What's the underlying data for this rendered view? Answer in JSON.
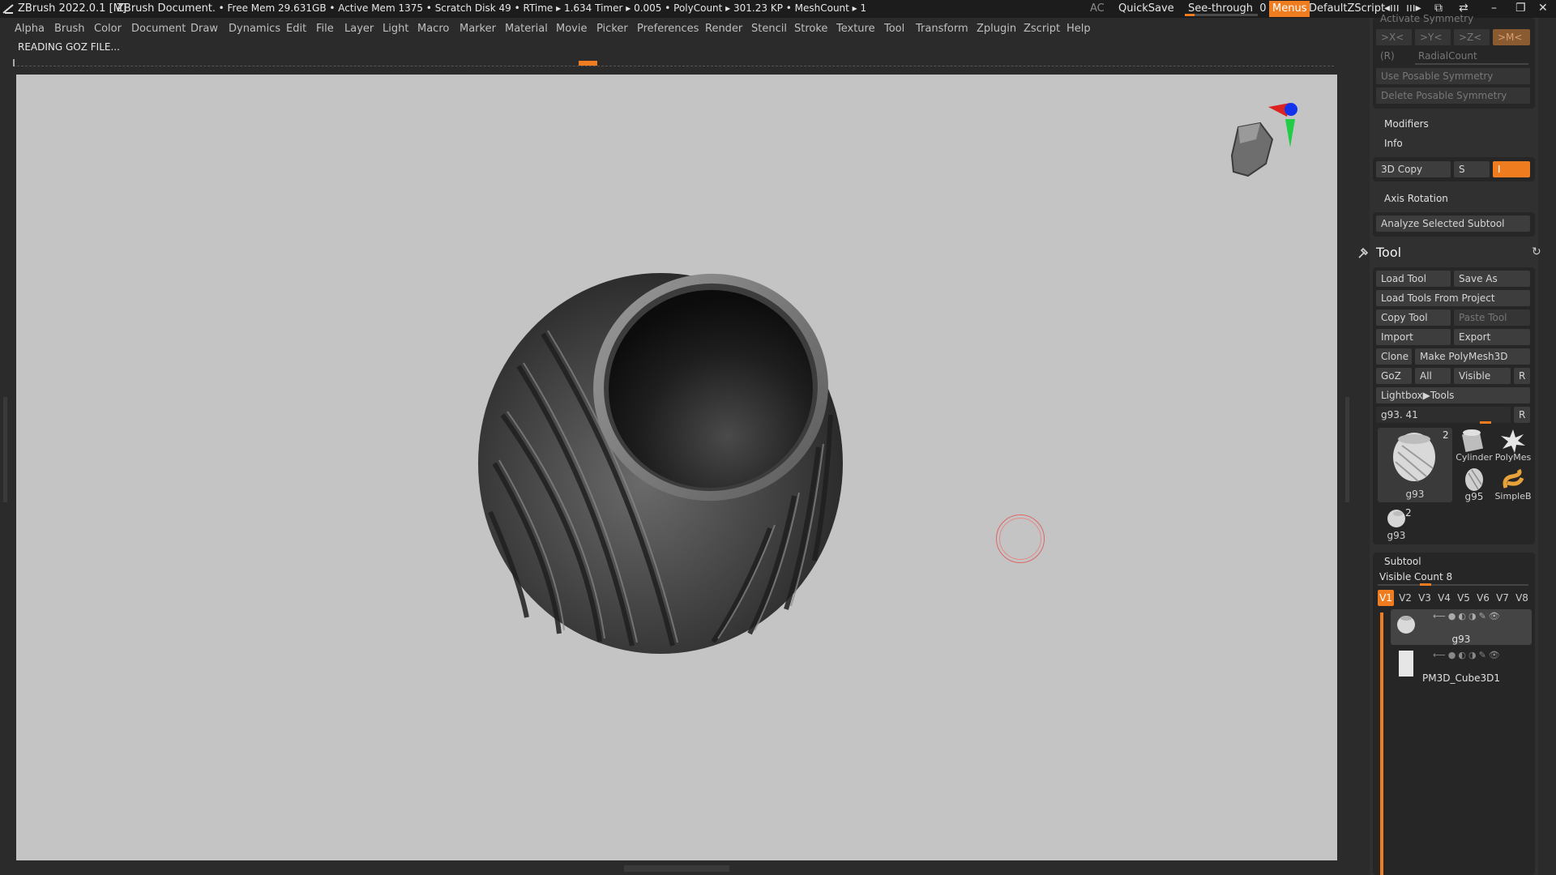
{
  "titlebar": {
    "app": "ZBrush 2022.0.1 [M]",
    "document": "ZBrush Document",
    "stats": ". • Free Mem 29.631GB • Active Mem 1375 • Scratch Disk 49 •  RTime ▸ 1.634 Timer ▸ 0.005 • PolyCount ▸ 301.23 KP  • MeshCount ▸ 1",
    "ac": "AC",
    "quicksave": "QuickSave",
    "seethrough": "See-through",
    "seethrough_value": "0",
    "seethrough_level": 0,
    "menus": "Menus",
    "script": "DefaultZScript"
  },
  "menubar": [
    "Alpha",
    "Brush",
    "Color",
    "Document",
    "Draw",
    "Dynamics",
    "Edit",
    "File",
    "Layer",
    "Light",
    "Macro",
    "Marker",
    "Material",
    "Movie",
    "Picker",
    "Preferences",
    "Render",
    "Stencil",
    "Stroke",
    "Texture",
    "Tool",
    "Transform",
    "Zplugin",
    "Zscript",
    "Help"
  ],
  "notice": "READING GOZ FILE...",
  "panel": {
    "symmetry": {
      "header": "Activate Symmetry",
      "x": ">X<",
      "y": ">Y<",
      "z": ">Z<",
      "m": ">M<",
      "r": "(R)",
      "radial": "RadialCount",
      "use_posable": "Use Posable Symmetry",
      "delete_posable": "Delete Posable Symmetry"
    },
    "modifiers": "Modifiers",
    "info": "Info",
    "copy3d": "3D Copy",
    "copy3d_s": "S",
    "copy3d_i": "I",
    "axis_rotation": "Axis Rotation",
    "analyze": "Analyze Selected Subtool",
    "tool": {
      "title": "Tool",
      "load_tool": "Load Tool",
      "save_as": "Save As",
      "load_from_project": "Load Tools From Project",
      "copy_tool": "Copy Tool",
      "paste_tool": "Paste Tool",
      "import": "Import",
      "export": "Export",
      "clone": "Clone",
      "make_polymesh": "Make PolyMesh3D",
      "goz": "GoZ",
      "all": "All",
      "visible": "Visible",
      "r": "R",
      "lightbox": "Lightbox▶Tools",
      "current": "g93. 41",
      "current_r": "R",
      "thumbs": [
        {
          "label": "g93",
          "count": "2"
        },
        {
          "label": "Cylinder"
        },
        {
          "label": "PolyMes"
        },
        {
          "label": "g95"
        },
        {
          "label": "SimpleB"
        },
        {
          "label": "g93",
          "count": "2"
        }
      ]
    },
    "subtool": {
      "title": "Subtool",
      "visible_count": "Visible Count 8",
      "tabs": [
        "V1",
        "V2",
        "V3",
        "V4",
        "V5",
        "V6",
        "V7",
        "V8"
      ],
      "items": [
        {
          "name": "g93"
        },
        {
          "name": "PM3D_Cube3D1"
        }
      ]
    }
  },
  "colors": {
    "accent": "#ef7d1f",
    "canvas": "#c4c4c4",
    "panel": "#303030"
  }
}
